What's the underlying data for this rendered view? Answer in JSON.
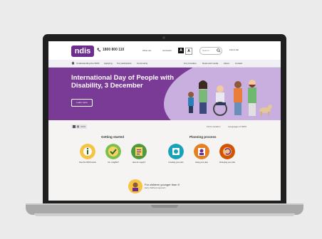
{
  "header": {
    "logo_text": "ndis",
    "phone": "1800 800 110",
    "links": [
      "Other lan",
      "Accessibi"
    ],
    "accessibility_buttons": [
      "A",
      "A"
    ],
    "search_placeholder": "Search",
    "language_label": "Find a lan"
  },
  "nav": {
    "items": [
      "Understanding the NDIS",
      "Applying",
      "For participants",
      "Community",
      "For providers",
      "News and media",
      "About",
      "Contact"
    ]
  },
  "hero": {
    "title": "International Day of People with Disability, 3 December",
    "button_label": "Learn more"
  },
  "utility": {
    "left_label": "AA",
    "right_items": [
      "Find a location",
      "Languages of NDIS"
    ]
  },
  "sections": {
    "getting_started": {
      "heading": "Getting started",
      "tiles": [
        {
          "label": "How the NDIS works",
          "color": "#f6c445",
          "icon": "info-icon"
        },
        {
          "label": "Am I eligible?",
          "color": "#7cc04b",
          "icon": "checkmark-icon"
        },
        {
          "label": "How do I apply?",
          "color": "#4f9a3f",
          "icon": "form-icon"
        }
      ]
    },
    "planning_process": {
      "heading": "Planning process",
      "tiles": [
        {
          "label": "Creating your plan",
          "color": "#17a2b8",
          "icon": "plan-icon"
        },
        {
          "label": "Using your plan",
          "color": "#e67e22",
          "icon": "person-icon"
        },
        {
          "label": "Changing your plan",
          "color": "#d35400",
          "icon": "refresh-icon"
        }
      ]
    }
  },
  "promo": {
    "title": "For children younger than 9",
    "subtitle": "Early childhood approach",
    "icon": "child-icon"
  },
  "colors": {
    "brand_purple": "#6c2d8f",
    "hero_background": "#7a3b96",
    "hero_accent": "#c9aee0"
  }
}
